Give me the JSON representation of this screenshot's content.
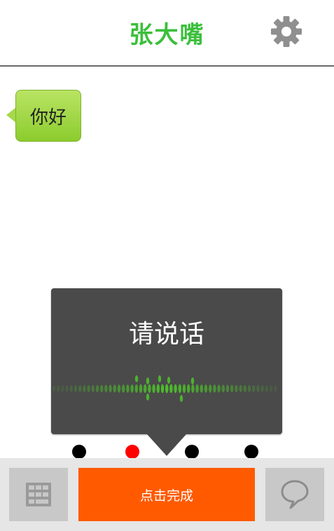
{
  "header": {
    "title": "张大嘴",
    "settings_icon": "gear-icon"
  },
  "chat": {
    "messages": [
      {
        "text": "你好"
      }
    ]
  },
  "voice_popup": {
    "prompt": "请说话",
    "waveform_icon": "voice-waveform-icon"
  },
  "page_indicator": {
    "count": 4,
    "active_index": 1
  },
  "bottom_bar": {
    "keyboard_icon": "keyboard-icon",
    "finish_label": "点击完成",
    "chat_icon": "speech-bubble-icon"
  },
  "colors": {
    "accent": "#3bbf3b",
    "bubble": "#a6d84c",
    "popup": "#4a4a4a",
    "finish": "#ff5a00",
    "dot": "#000000",
    "dot_active": "#ff0000",
    "waveform": "#4cbf2a"
  }
}
